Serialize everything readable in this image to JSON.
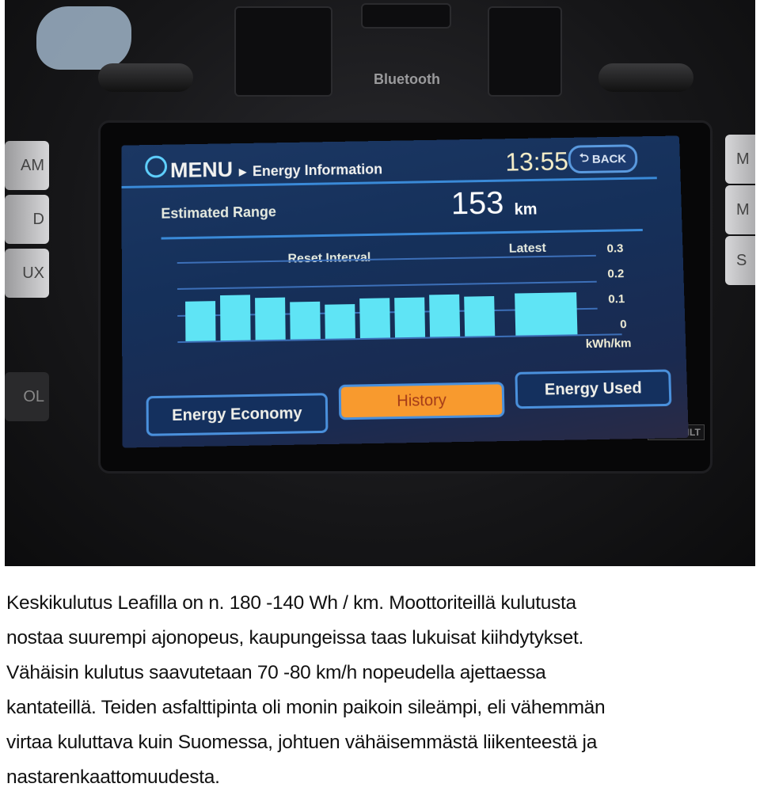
{
  "photo": {
    "bluetooth_label": "Bluetooth",
    "left_buttons": [
      "AM",
      "D",
      "UX",
      "OL"
    ],
    "right_buttons": [
      "M",
      "M",
      "S"
    ],
    "open_tilt_label": "OPEN/TILT",
    "screen": {
      "menu_label": "MENU",
      "breadcrumb_separator": "▸",
      "breadcrumb_page": "Energy Information",
      "clock": "13:55",
      "back_button": "BACK",
      "estimated_range_label": "Estimated Range",
      "estimated_range_value": "153",
      "estimated_range_unit": "km",
      "tabs": [
        {
          "label": "Energy Economy",
          "active": false
        },
        {
          "label": "History",
          "active": true
        },
        {
          "label": "Energy Used",
          "active": false
        }
      ],
      "colors": {
        "bar": "#5fe4f5",
        "active_tab": "#f89a2e",
        "screen_bg": "#1b3763",
        "accent_line": "#3a8ad8"
      }
    }
  },
  "chart_data": {
    "type": "bar",
    "xlabel": "Reset Interval",
    "latest_label": "Latest",
    "ylabel": "kWh/km",
    "yticks": [
      "0.3",
      "0.2",
      "0.1",
      "0"
    ],
    "ylim": [
      0,
      0.3
    ],
    "grid": true,
    "values": [
      0.15,
      0.17,
      0.16,
      0.14,
      0.13,
      0.15,
      0.15,
      0.16,
      0.15
    ],
    "latest_value": 0.16
  },
  "caption": {
    "lines": [
      "Keskikulutus Leafilla on n. 180 -140 Wh / km. Moottoriteillä kulutusta",
      "nostaa suurempi ajonopeus, kaupungeissa taas lukuisat kiihdytykset.",
      "Vähäisin kulutus saavutetaan 70 -80 km/h nopeudella ajettaessa",
      "kantateillä. Teiden asfalttipinta oli monin paikoin sileämpi, eli vähemmän",
      "virtaa kuluttava kuin Suomessa, johtuen vähäisemmästä liikenteestä ja",
      "nastarenkaattomuudesta."
    ]
  }
}
